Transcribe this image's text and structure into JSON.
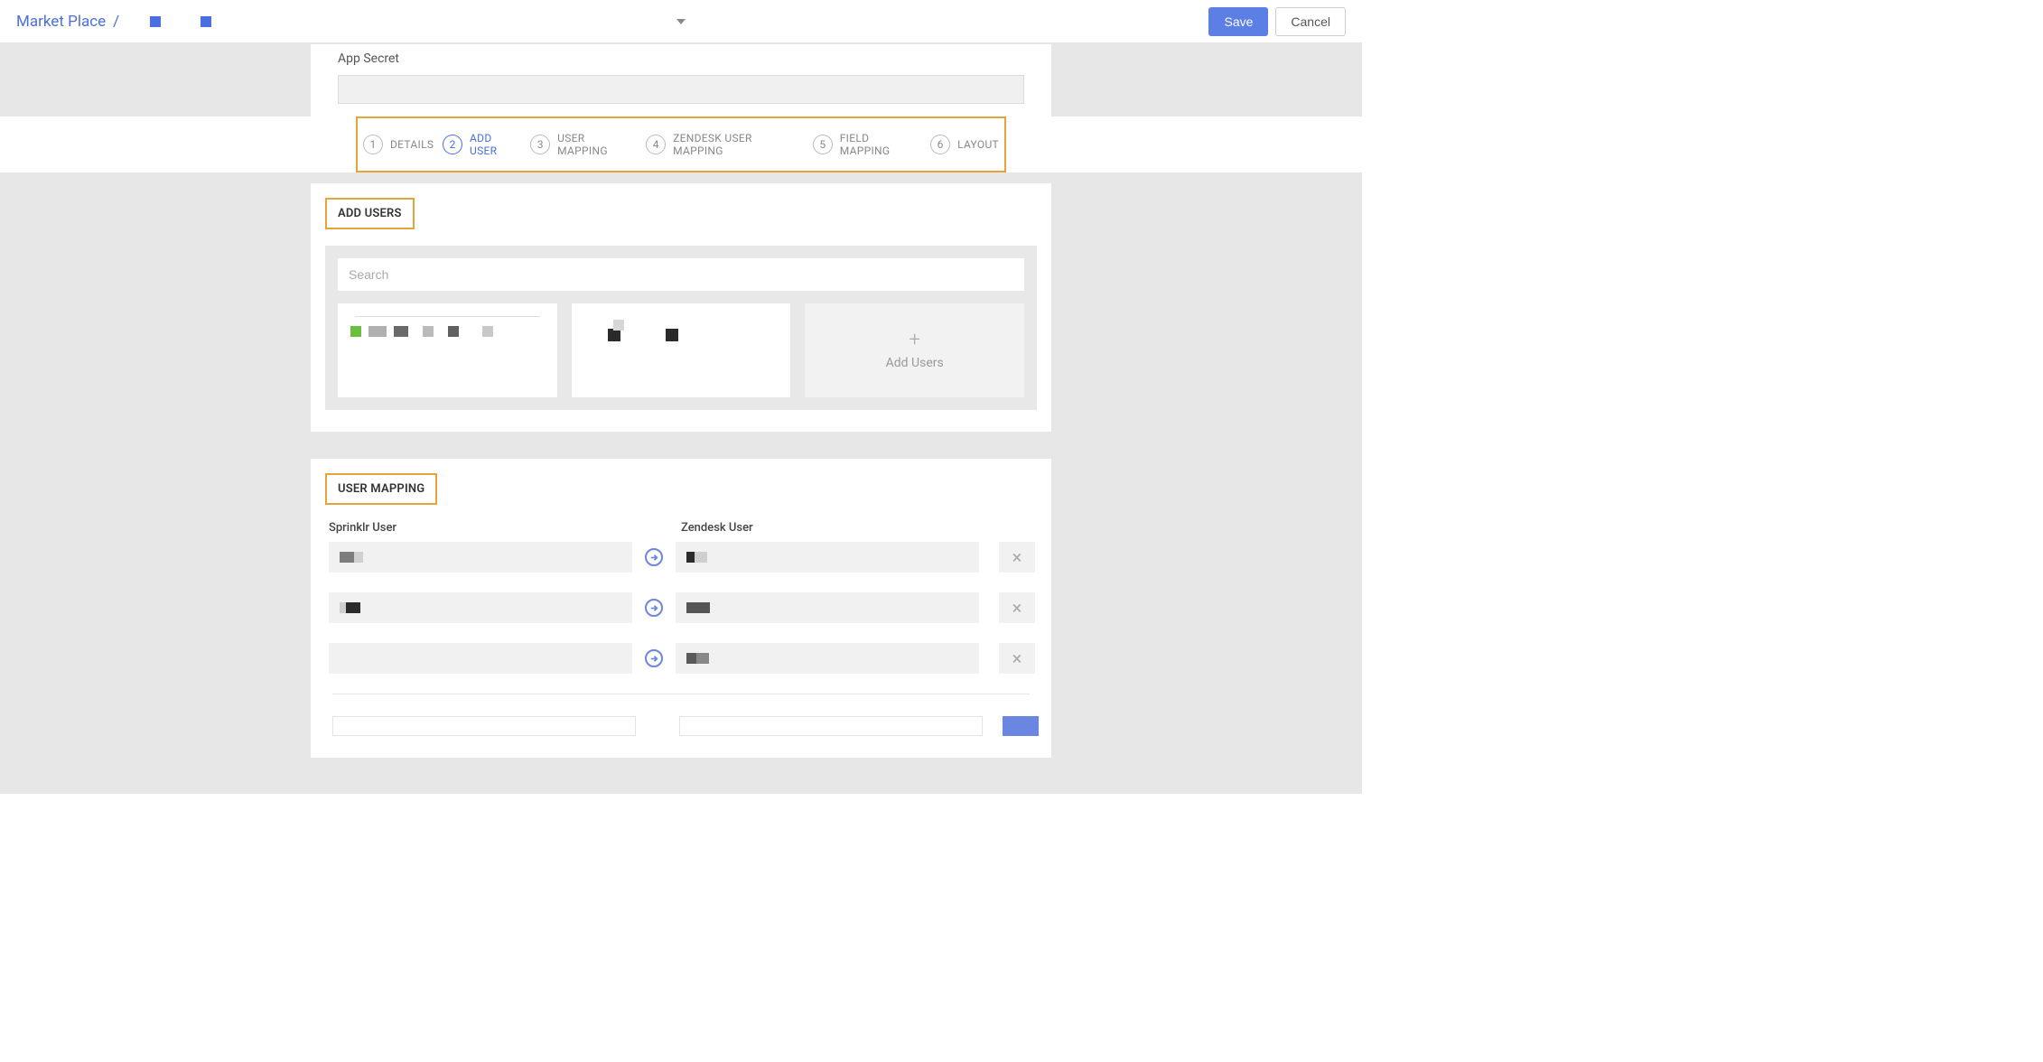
{
  "header": {
    "breadcrumb_root": "Market Place",
    "breadcrumb_sep": "/",
    "save_label": "Save",
    "cancel_label": "Cancel"
  },
  "peek": {
    "label": "App Secret",
    "value_masked": ""
  },
  "stepper": {
    "steps": [
      {
        "num": "1",
        "label": "DETAILS"
      },
      {
        "num": "2",
        "label": "ADD USER"
      },
      {
        "num": "3",
        "label": "USER MAPPING"
      },
      {
        "num": "4",
        "label": "ZENDESK USER MAPPING"
      },
      {
        "num": "5",
        "label": "FIELD MAPPING"
      },
      {
        "num": "6",
        "label": "LAYOUT"
      }
    ],
    "active_index": 1
  },
  "add_users": {
    "title": "ADD USERS",
    "search_placeholder": "Search",
    "add_card_label": "Add Users"
  },
  "user_mapping": {
    "title": "USER MAPPING",
    "left_header": "Sprinklr User",
    "right_header": "Zendesk User",
    "rows": [
      {
        "sprinklr": "",
        "zendesk": ""
      },
      {
        "sprinklr": "",
        "zendesk": ""
      },
      {
        "sprinklr": "",
        "zendesk": ""
      }
    ]
  }
}
